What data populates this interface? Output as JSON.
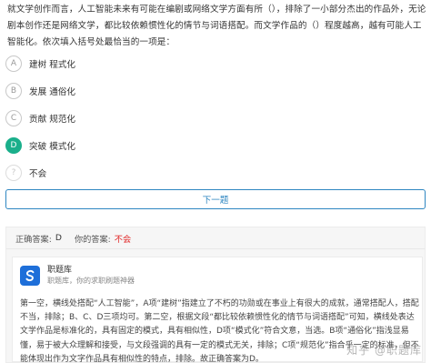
{
  "question": {
    "text": "就文学创作而言，人工智能未来有可能在编剧或网络文学方面有所（），排除了一小部分杰出的作品外，无论剧本创作还是网络文学，都比较依赖惯性化的情节与词语搭配。而文学作品的（）程度越高，越有可能人工智能化。依次填入括号处最恰当的一项是："
  },
  "options": [
    {
      "letter": "A",
      "text": "建树 程式化",
      "state": "normal"
    },
    {
      "letter": "B",
      "text": "发展 通俗化",
      "state": "normal"
    },
    {
      "letter": "C",
      "text": "贡献 规范化",
      "state": "normal"
    },
    {
      "letter": "D",
      "text": "突破 模式化",
      "state": "selected"
    },
    {
      "letter": "?",
      "text": "不会",
      "state": "unknown"
    }
  ],
  "next_button": {
    "label": "下一题"
  },
  "answer": {
    "correct_label": "正确答案:",
    "correct_value": "D",
    "yours_label": "你的答案:",
    "yours_value": "不会"
  },
  "explanation": {
    "brand_name": "职题库",
    "brand_slogan": "职题库，你的求职刷题神器",
    "text": "第一空，横线处搭配“人工智能”，A项“建树”指建立了不朽的功勋或在事业上有很大的成就，通常搭配人，搭配不当，排除；B、C、D三项均可。第二空，根据文段“都比较依赖惯性化的情节与词语搭配”可知，横线处表达文学作品是标准化的，具有固定的模式，具有相似性，D项“模式化”符合文意，当选。B项“通俗化”指浅显易懂，易于被大众理解和接受，与文段强调的具有一定的模式无关，排除；C项“规范化”指合乎一定的标准，但不能体现出作为文字作品具有相似性的特点，排除。故正确答案为D。"
  },
  "watermark": "知乎 @职题库",
  "colors": {
    "accent_green": "#1aaf8b",
    "accent_blue": "#2e86c1",
    "red": "#e02020",
    "brand_blue": "#1e6fd9"
  }
}
